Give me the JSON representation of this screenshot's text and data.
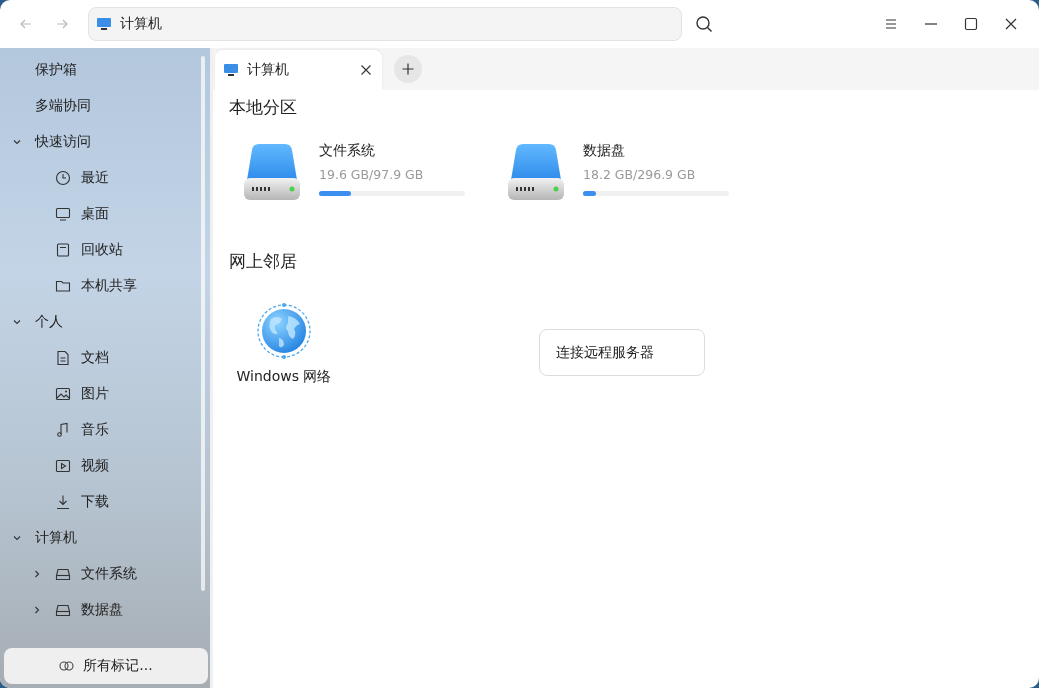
{
  "navigation": {
    "back": {
      "disabled": true
    },
    "forward": {
      "disabled": true
    }
  },
  "address_bar": {
    "value": "计算机"
  },
  "sidebar": {
    "items": [
      {
        "label": "保护箱"
      },
      {
        "label": "多端协同"
      },
      {
        "label": "快速访问",
        "expanded": true,
        "children": [
          {
            "label": "最近"
          },
          {
            "label": "桌面"
          },
          {
            "label": "回收站"
          },
          {
            "label": "本机共享"
          }
        ]
      },
      {
        "label": "个人",
        "expanded": true,
        "children": [
          {
            "label": "文档"
          },
          {
            "label": "图片"
          },
          {
            "label": "音乐"
          },
          {
            "label": "视频"
          },
          {
            "label": "下载"
          }
        ]
      },
      {
        "label": "计算机",
        "expanded": true,
        "children": [
          {
            "label": "文件系统",
            "expanded": false
          },
          {
            "label": "数据盘",
            "expanded": false
          }
        ]
      }
    ],
    "footer_button": "所有标记..."
  },
  "tabs": [
    {
      "label": "计算机",
      "selected": true
    }
  ],
  "sections": [
    {
      "title": "本地分区",
      "drives": [
        {
          "name": "文件系统",
          "usage": "19.6 GB/97.9 GB",
          "level": 0.22
        },
        {
          "name": "数据盘",
          "usage": "18.2 GB/296.9 GB",
          "level": 0.09
        }
      ]
    },
    {
      "title": "网上邻居",
      "network": {
        "label": "Windows 网络"
      },
      "connect_button": "连接远程服务器"
    }
  ]
}
